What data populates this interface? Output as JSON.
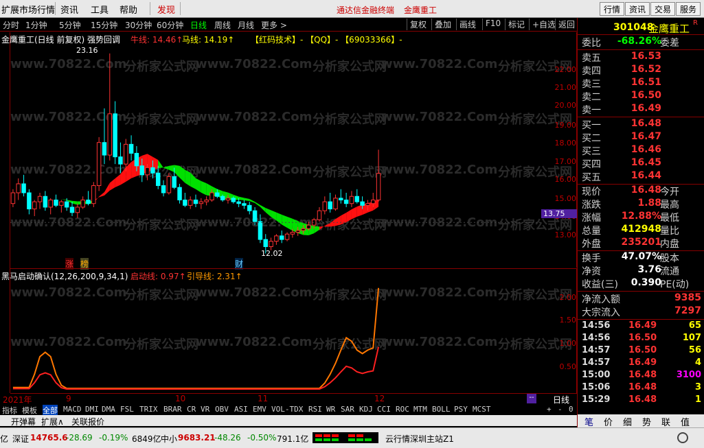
{
  "menu": {
    "items": [
      "扩展市场行情",
      "资讯",
      "工具",
      "帮助",
      "发现"
    ],
    "center_links": [
      "通达信金融终端",
      "金鹰重工"
    ],
    "right_buttons": [
      "行情",
      "资讯",
      "交易",
      "服务"
    ]
  },
  "periods": [
    "分时",
    "1分钟",
    "5分钟",
    "15分钟",
    "30分钟",
    "60分钟",
    "日线",
    "周线",
    "月线",
    "更多 >"
  ],
  "toolbar_right": [
    "复权",
    "叠加",
    "画线",
    "F10",
    "标记",
    "+自选",
    "返回"
  ],
  "main_chart": {
    "title": "金鹰重工(日线 前复权) 强势回调",
    "niu_label": "牛线: 14.46↑",
    "ma_label": "马线: 14.19↑",
    "promo": "【红码技术】- 【QQ】- 【69033366】-",
    "watermark1": "www.70822.Com",
    "watermark2": "分析家公式网",
    "high_label": "23.16",
    "low_label": "12.02",
    "current_price_tag": "13.75",
    "badge_zhang": "涨",
    "badge_bang": "榜",
    "badge_cai": "财"
  },
  "indicator": {
    "title": "黑马启动确认(12,26,200,9,34,1)",
    "qidong": "启动线: 0.97↑",
    "yindao": "引导线: 2.31↑"
  },
  "x_axis": {
    "labels": [
      "2021年",
      "9",
      "10",
      "11",
      "12"
    ],
    "period_label": "日线"
  },
  "ind_tabs": [
    "指标",
    "模板",
    "全部",
    "MACD",
    "DMI",
    "DMA",
    "FSL",
    "TRIX",
    "BRAR",
    "CR",
    "VR",
    "OBV",
    "ASI",
    "EMV",
    "VOL-TDX",
    "RSI",
    "WR",
    "SAR",
    "KDJ",
    "CCI",
    "ROC",
    "MTM",
    "BOLL",
    "PSY",
    "MCST"
  ],
  "bottom_tabs": [
    "开弹幕",
    "扩展∧",
    "关联报价"
  ],
  "status": {
    "sz_label": "深证",
    "sz_value": "14765.6",
    "sz_change": "-28.69",
    "sz_pct": "-0.19%",
    "sz_amount": "6849亿",
    "zx_label": "中小",
    "zx_value": "9683.21",
    "zx_change": "-48.26",
    "zx_pct": "-0.50%",
    "zx_amount": "791.1亿",
    "server": "云行情深圳主站Z1",
    "prefix": "亿"
  },
  "quote": {
    "code": "301048",
    "name": "金鹰重工",
    "weibi_label": "委比",
    "weibi": "-68.26%",
    "weicha_label": "委差",
    "asks": [
      {
        "label": "卖五",
        "price": "16.53"
      },
      {
        "label": "卖四",
        "price": "16.52"
      },
      {
        "label": "卖三",
        "price": "16.51"
      },
      {
        "label": "卖二",
        "price": "16.50"
      },
      {
        "label": "卖一",
        "price": "16.49"
      }
    ],
    "bids": [
      {
        "label": "买一",
        "price": "16.48"
      },
      {
        "label": "买二",
        "price": "16.47"
      },
      {
        "label": "买三",
        "price": "16.46"
      },
      {
        "label": "买四",
        "price": "16.45"
      },
      {
        "label": "买五",
        "price": "16.44"
      }
    ],
    "stats": [
      {
        "label": "现价",
        "value": "16.48",
        "right": "今开"
      },
      {
        "label": "涨跌",
        "value": "1.88",
        "right": "最高"
      },
      {
        "label": "涨幅",
        "value": "12.88%",
        "right": "最低"
      },
      {
        "label": "总量",
        "value": "412948",
        "right": "量比"
      },
      {
        "label": "外盘",
        "value": "235201",
        "right": "内盘"
      },
      {
        "label": "换手",
        "value": "47.07%",
        "right": "股本"
      },
      {
        "label": "净资",
        "value": "3.76",
        "right": "流通"
      },
      {
        "label": "收益(三)",
        "value": "0.390",
        "right": "PE(动)"
      }
    ],
    "flow": [
      {
        "label": "净流入额",
        "value": "9385"
      },
      {
        "label": "大宗流入",
        "value": "7297"
      }
    ],
    "ticks": [
      {
        "time": "14:56",
        "price": "16.49",
        "vol": "65"
      },
      {
        "time": "14:56",
        "price": "16.50",
        "vol": "107"
      },
      {
        "time": "14:57",
        "price": "16.50",
        "vol": "56"
      },
      {
        "time": "14:57",
        "price": "16.49",
        "vol": "4"
      },
      {
        "time": "15:00",
        "price": "16.48",
        "vol": "3100"
      },
      {
        "time": "15:06",
        "price": "16.48",
        "vol": "3"
      },
      {
        "time": "15:29",
        "price": "16.48",
        "vol": "1"
      }
    ],
    "tabs": [
      "笔",
      "价",
      "细",
      "势",
      "联",
      "值"
    ]
  },
  "y_ticks_main": [
    "22.00",
    "21.00",
    "20.00",
    "19.00",
    "18.00",
    "17.00",
    "16.00",
    "15.00",
    "14.00",
    "13.00"
  ],
  "y_ticks_ind": [
    "2.00",
    "1.50",
    "1.00",
    "0.50"
  ],
  "scroll_controls": [
    "+",
    "-",
    "0"
  ],
  "colors": {
    "up": "#ff3333",
    "down": "#00ffff",
    "bg": "#000000",
    "grid": "#800000"
  },
  "chart_data": {
    "type": "candlestick",
    "candles": [
      [
        14.8,
        15.6,
        14.6,
        15.4
      ],
      [
        15.4,
        16.2,
        15.0,
        15.9
      ],
      [
        15.9,
        16.4,
        15.2,
        15.4
      ],
      [
        15.4,
        15.6,
        14.2,
        14.5
      ],
      [
        14.5,
        15.0,
        14.1,
        14.9
      ],
      [
        14.9,
        15.4,
        14.5,
        15.2
      ],
      [
        15.2,
        15.5,
        14.4,
        14.6
      ],
      [
        14.6,
        15.1,
        14.2,
        15.0
      ],
      [
        15.0,
        15.3,
        14.6,
        14.7
      ],
      [
        14.7,
        15.0,
        14.3,
        14.9
      ],
      [
        14.9,
        15.1,
        14.4,
        14.6
      ],
      [
        14.6,
        14.9,
        14.1,
        14.3
      ],
      [
        14.3,
        14.8,
        14.0,
        14.6
      ],
      [
        14.6,
        15.2,
        14.5,
        15.0
      ],
      [
        15.0,
        15.5,
        14.7,
        14.8
      ],
      [
        14.8,
        16.0,
        14.6,
        15.8
      ],
      [
        15.8,
        18.5,
        15.5,
        18.2
      ],
      [
        18.2,
        20.1,
        17.0,
        17.5
      ],
      [
        17.5,
        23.16,
        17.2,
        19.8
      ],
      [
        19.8,
        20.5,
        17.0,
        17.4
      ],
      [
        17.4,
        18.2,
        16.5,
        17.0
      ],
      [
        17.0,
        18.4,
        16.6,
        18.1
      ],
      [
        18.1,
        18.6,
        17.2,
        17.6
      ],
      [
        17.6,
        18.0,
        16.6,
        16.9
      ],
      [
        16.9,
        17.3,
        16.0,
        16.4
      ],
      [
        16.4,
        17.0,
        16.1,
        16.8
      ],
      [
        16.8,
        17.2,
        16.2,
        16.5
      ],
      [
        16.5,
        16.9,
        15.6,
        15.8
      ],
      [
        15.8,
        16.1,
        15.2,
        15.4
      ],
      [
        15.4,
        16.5,
        15.3,
        16.3
      ],
      [
        16.3,
        16.8,
        15.6,
        15.7
      ],
      [
        15.7,
        15.9,
        14.8,
        15.0
      ],
      [
        15.0,
        15.4,
        14.6,
        14.7
      ],
      [
        14.7,
        15.2,
        14.5,
        15.0
      ],
      [
        15.0,
        15.3,
        14.6,
        14.8
      ],
      [
        14.8,
        15.1,
        14.5,
        14.9
      ],
      [
        14.9,
        15.2,
        14.7,
        15.0
      ],
      [
        15.0,
        15.6,
        14.9,
        15.4
      ],
      [
        15.4,
        15.6,
        15.1,
        15.2
      ],
      [
        15.2,
        15.3,
        14.9,
        15.0
      ],
      [
        15.0,
        15.3,
        14.8,
        15.1
      ],
      [
        15.1,
        15.2,
        14.8,
        14.9
      ],
      [
        14.9,
        15.1,
        14.6,
        14.8
      ],
      [
        14.8,
        15.0,
        14.5,
        14.7
      ],
      [
        14.7,
        14.9,
        14.2,
        14.4
      ],
      [
        14.4,
        14.6,
        13.6,
        13.8
      ],
      [
        13.8,
        14.2,
        12.6,
        12.8
      ],
      [
        12.8,
        13.1,
        12.02,
        12.4
      ],
      [
        12.4,
        12.9,
        12.2,
        12.7
      ],
      [
        12.7,
        13.1,
        12.5,
        13.0
      ],
      [
        13.0,
        13.3,
        12.6,
        12.8
      ],
      [
        12.8,
        13.2,
        12.7,
        13.1
      ],
      [
        13.1,
        13.4,
        12.9,
        13.2
      ],
      [
        13.2,
        13.5,
        13.0,
        13.3
      ],
      [
        13.3,
        13.6,
        13.1,
        13.4
      ],
      [
        13.4,
        13.8,
        13.3,
        13.6
      ],
      [
        13.6,
        14.0,
        13.4,
        13.9
      ],
      [
        13.9,
        14.6,
        13.8,
        14.4
      ],
      [
        14.4,
        15.2,
        14.2,
        14.9
      ],
      [
        14.9,
        15.4,
        14.3,
        14.5
      ],
      [
        14.5,
        15.3,
        14.4,
        15.1
      ],
      [
        15.1,
        15.6,
        14.8,
        15.0
      ],
      [
        15.0,
        15.4,
        14.6,
        14.8
      ],
      [
        14.8,
        15.5,
        14.6,
        15.2
      ],
      [
        15.2,
        15.6,
        14.8,
        14.9
      ],
      [
        14.9,
        15.2,
        14.5,
        14.7
      ],
      [
        14.7,
        15.0,
        14.4,
        14.8
      ],
      [
        14.8,
        15.4,
        14.6,
        15.0
      ],
      [
        15.0,
        17.8,
        14.9,
        16.48
      ]
    ],
    "ylim": [
      12.0,
      23.5
    ],
    "ind_ylim": [
      0,
      2.4
    ]
  }
}
